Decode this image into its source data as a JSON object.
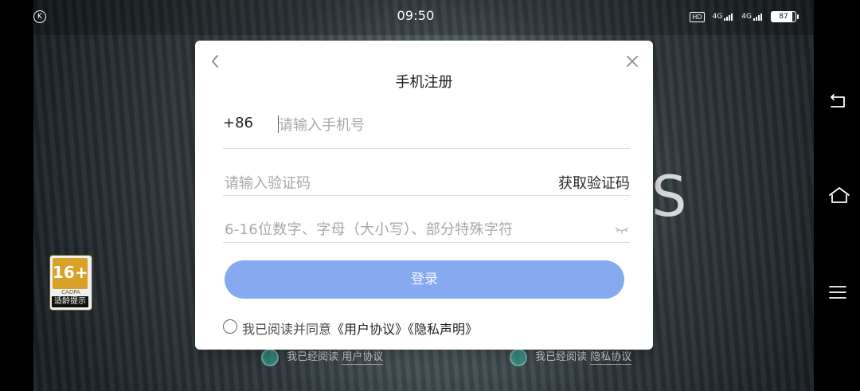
{
  "status_bar": {
    "time": "09:50",
    "left_icon_label": "K",
    "hd_label": "HD",
    "network_labels": [
      "4G",
      "4G"
    ],
    "battery": "87"
  },
  "dialog": {
    "title": "手机注册",
    "country_code": "+86",
    "phone_placeholder": "请输入手机号",
    "code_placeholder": "请输入验证码",
    "get_code_label": "获取验证码",
    "password_placeholder": "6-16位数字、字母（大小写）、部分特殊字符",
    "login_label": "登录",
    "agreement_prefix": "我已阅读并同意",
    "user_agreement": "《用户协议》",
    "privacy_statement": "《隐私声明》"
  },
  "background": {
    "letter": "S",
    "check_1_prefix": "我已经阅读",
    "check_1_link": "用户协议",
    "check_2_prefix": "我已经阅读",
    "check_2_link": "隐私协议"
  },
  "rating_badge": {
    "age": "16+",
    "org": "CADPA",
    "label": "适龄提示"
  },
  "navigation": {
    "back_icon": "back-icon",
    "home_icon": "home-icon",
    "menu_icon": "menu-icon"
  }
}
